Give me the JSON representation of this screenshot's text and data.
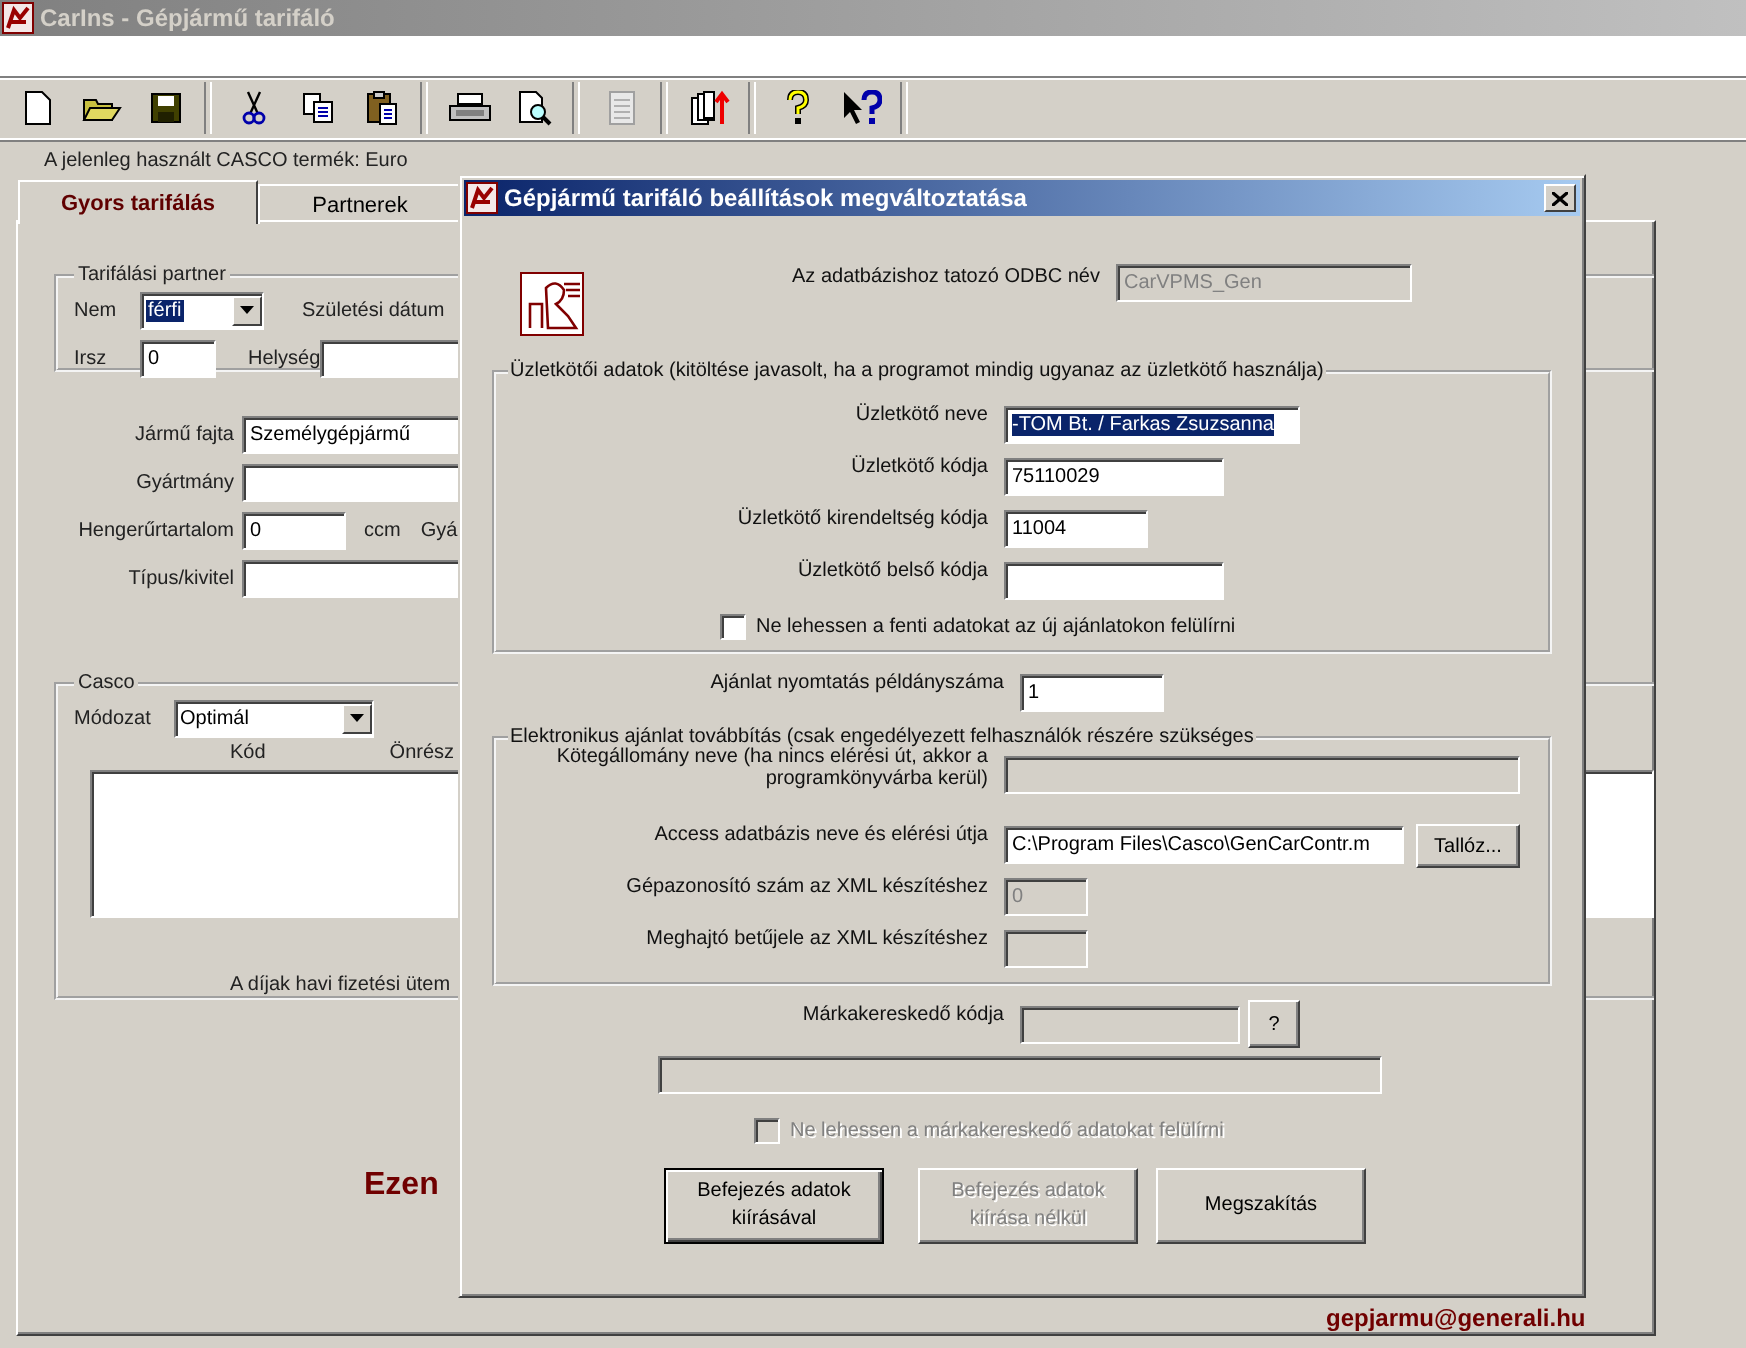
{
  "app_window": {
    "title": "CarIns - Gépjármű tarifáló"
  },
  "product_label": "A jelenleg használt CASCO termék: Euro",
  "tabs": [
    {
      "label": "Gyors tarifálás",
      "selected": true
    },
    {
      "label": "Partnerek",
      "selected": false
    }
  ],
  "partner_group": {
    "title": "Tarifálási partner",
    "gender_label": "Nem",
    "gender_value": "férfi",
    "birth_label": "Születési dátum",
    "zip_label": "Irsz",
    "zip_value": "0",
    "city_label": "Helység"
  },
  "vehicle": {
    "type_label": "Jármű fajta",
    "type_value": "Személygépjármű",
    "make_label": "Gyártmány",
    "engine_label": "Hengerűrtartalom",
    "engine_value": "0",
    "engine_unit": "ccm",
    "cut_label": "Gyá",
    "model_label": "Típus/kivitel"
  },
  "casco": {
    "title": "Casco",
    "plan_label": "Módozat",
    "plan_value": "Optimál",
    "columns": [
      "Kód",
      "Önrész"
    ],
    "footer": "A díjak havi fizetési ütem"
  },
  "banner": "Ezen",
  "email": "gepjarmu@generali.hu",
  "dialog": {
    "title": "Gépjármű tarifáló beállítások megváltoztatása",
    "odbc": {
      "label": "Az adatbázishoz tatozó ODBC név",
      "value": "CarVPMS_Gen",
      "disabled": true
    },
    "broker_group": {
      "title": "Üzletkötői adatok (kitöltése javasolt, ha a programot mindig ugyanaz az üzletkötő használja)",
      "fields": [
        {
          "label": "Üzletkötő neve",
          "value": "-TOM Bt. / Farkas Zsuzsanna",
          "disabled": false,
          "text_selected": true
        },
        {
          "label": "Üzletkötő kódja",
          "value": "75110029",
          "disabled": false,
          "text_selected": false
        },
        {
          "label": "Üzletkötő kirendeltség kódja",
          "value": "11004",
          "disabled": false,
          "text_selected": false
        },
        {
          "label": "Üzletkötő belső kódja",
          "disabled": false
        }
      ],
      "lock": {
        "label": "Ne lehessen a fenti adatokat az új ajánlatokon felülírni",
        "checked": false,
        "disabled": false
      }
    },
    "copies": {
      "label": "Ajánlat nyomtatás példányszáma",
      "value": "1"
    },
    "electronic_group": {
      "title": "Elektronikus ajánlat továbbítás (csak engedélyezett felhasználók részére szükséges",
      "fields": [
        {
          "kind": "text",
          "label": "Kötegállomány neve (ha nincs elérési út, akkor a programkönyvárba kerül)",
          "disabled": true
        },
        {
          "kind": "browse",
          "label": "Access adatbázis neve és elérési útja",
          "value": "C:\\Program Files\\Casco\\GenCarContr.m",
          "disabled": false,
          "button": "Tallóz..."
        },
        {
          "kind": "text",
          "label": "Gépazonosító szám az XML készítéshez",
          "value": "0",
          "disabled": true
        },
        {
          "kind": "text",
          "label": "Meghajtó betűjele az XML készítéshez",
          "disabled": true
        }
      ]
    },
    "dealer": {
      "label": "Márkakereskedő kódja",
      "disabled": true,
      "help_button": "?"
    },
    "dealer_name_disabled": true,
    "dealer_lock": {
      "label": "Ne lehessen a márkakereskedő adatokat felülírni",
      "checked": false,
      "disabled": true
    },
    "buttons": [
      {
        "label": "Befejezés adatok kiírásával",
        "disabled": false,
        "default": true
      },
      {
        "label": "Befejezés adatok kiírása nélkül",
        "disabled": true,
        "default": false
      },
      {
        "label": "Megszakítás",
        "disabled": false,
        "default": false
      }
    ]
  }
}
